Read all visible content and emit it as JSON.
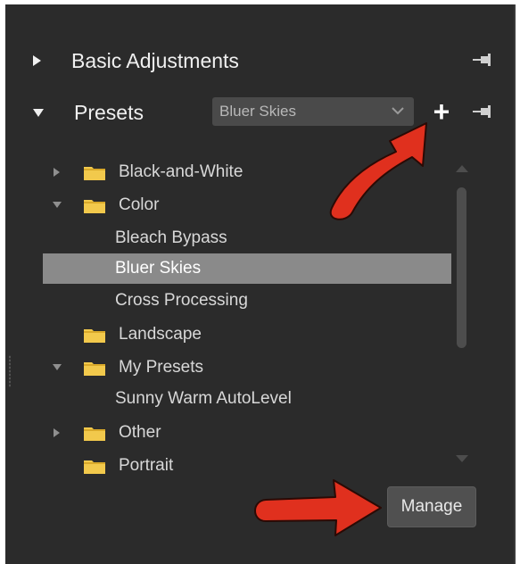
{
  "sections": {
    "basic_adjustments": {
      "title": "Basic Adjustments",
      "expanded": false
    },
    "presets": {
      "title": "Presets",
      "expanded": true
    }
  },
  "preset_select": {
    "value": "Bluer Skies"
  },
  "add_button": {
    "label": "+"
  },
  "tree": {
    "rows": [
      {
        "label": "Black-and-White",
        "type": "folder",
        "expanded": false
      },
      {
        "label": "Color",
        "type": "folder",
        "expanded": true
      },
      {
        "label": "Bleach Bypass",
        "type": "preset",
        "selected": false
      },
      {
        "label": "Bluer Skies",
        "type": "preset",
        "selected": true
      },
      {
        "label": "Cross Processing",
        "type": "preset",
        "selected": false
      },
      {
        "label": "Landscape",
        "type": "folder",
        "expanded": false
      },
      {
        "label": "My Presets",
        "type": "folder",
        "expanded": true
      },
      {
        "label": "Sunny Warm AutoLevel",
        "type": "preset",
        "selected": false
      },
      {
        "label": "Other",
        "type": "folder",
        "expanded": false
      },
      {
        "label": "Portrait",
        "type": "folder",
        "expanded": false
      }
    ]
  },
  "manage_button": {
    "label": "Manage"
  },
  "colors": {
    "panel_bg": "#2b2b2b",
    "selection": "#8a8a8a",
    "folder": "#f2c94c",
    "annotation_arrow": "#e0301e"
  },
  "icons": [
    "chevron-right-icon",
    "chevron-down-icon",
    "pin-icon",
    "folder-icon",
    "plus-icon",
    "dropdown-chevron-icon"
  ]
}
